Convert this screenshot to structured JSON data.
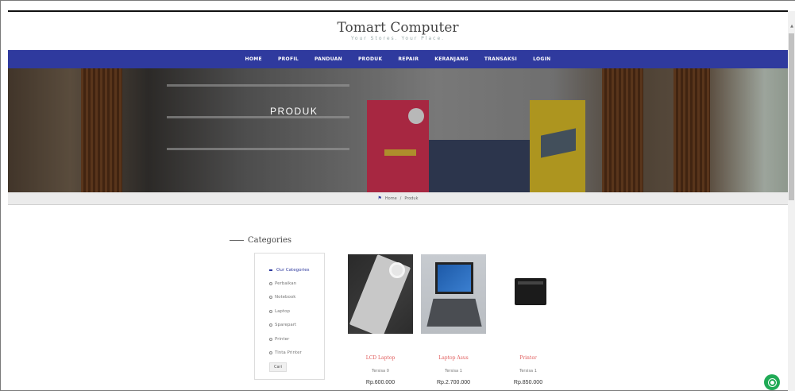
{
  "site": {
    "title": "Tomart Computer",
    "tagline": "Your Stores. Your Place."
  },
  "nav": {
    "items": [
      "HOME",
      "PROFIL",
      "PANDUAN",
      "PRODUK",
      "REPAIR",
      "KERANJANG",
      "TRANSAKSI",
      "LOGIN"
    ]
  },
  "hero": {
    "title": "PRODUK"
  },
  "breadcrumb": {
    "home": "Home",
    "separator": "/",
    "current": "Produk"
  },
  "sidebar": {
    "title": "Categories",
    "header": "Our Categories",
    "items": [
      "Perbaikan",
      "Notebook",
      "Laptop",
      "Sparepart",
      "Printer",
      "Tinta Printer"
    ],
    "button": "Cari"
  },
  "products": [
    {
      "name": "LCD Laptop",
      "stock": "Tersisa 0",
      "price": "Rp.600.000"
    },
    {
      "name": "Laptop Asus",
      "stock": "Tersisa 1",
      "price": "Rp.2.700.000"
    },
    {
      "name": "Printer",
      "stock": "Tersisa 1",
      "price": "Rp.850.000"
    }
  ],
  "icons": {
    "home": "home-icon",
    "chat": "chat-icon"
  },
  "colors": {
    "nav_bg": "#2f3a9e",
    "product_name": "#e05a5a",
    "chat": "#1faa55"
  }
}
